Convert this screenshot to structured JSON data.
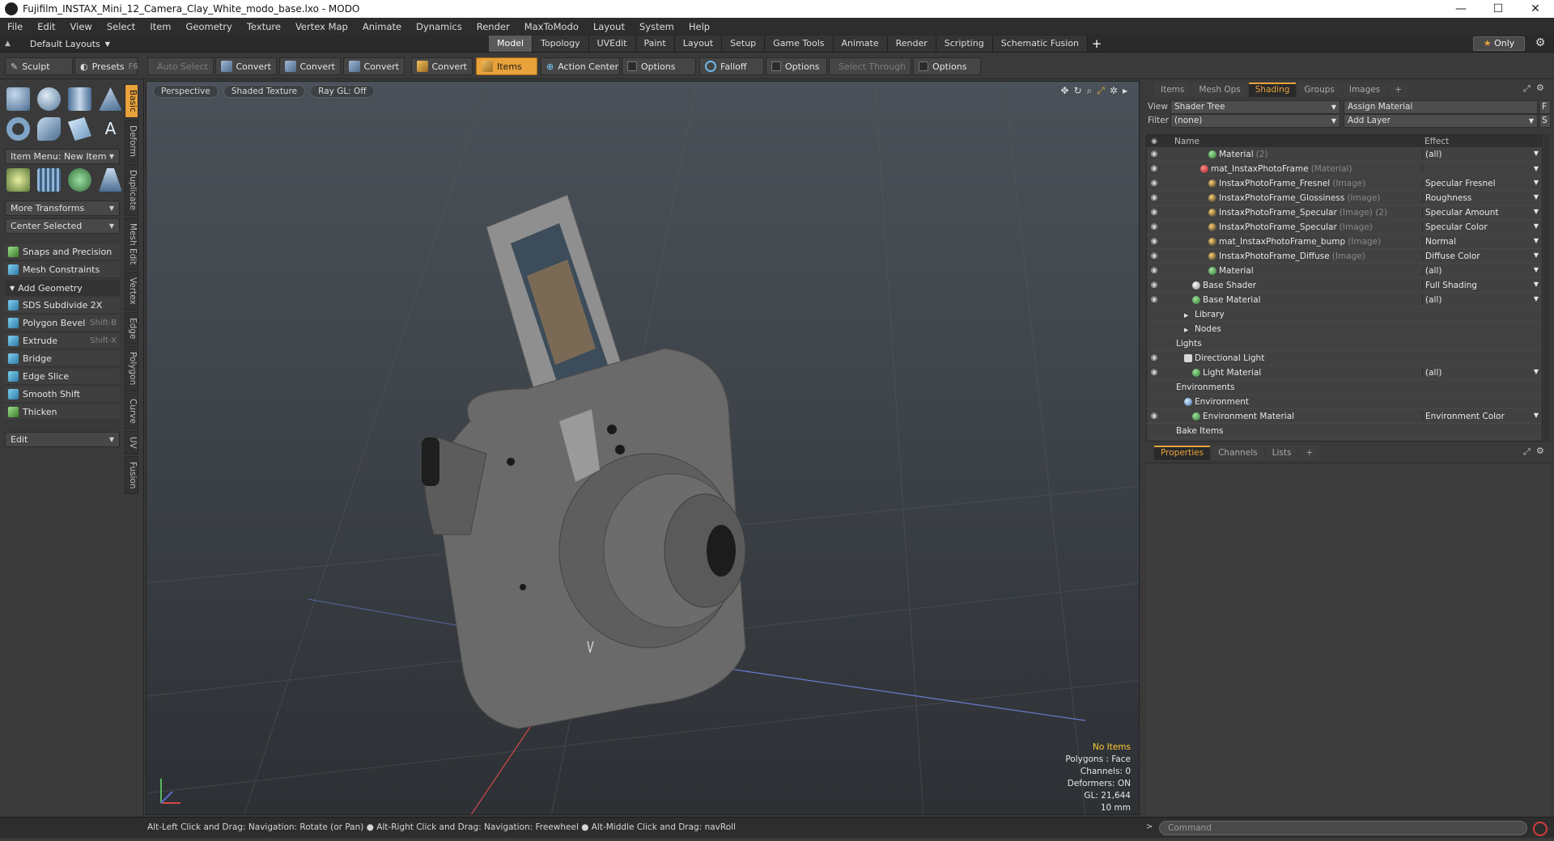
{
  "window": {
    "title": "Fujifilm_INSTAX_Mini_12_Camera_Clay_White_modo_base.lxo - MODO",
    "minimize": "—",
    "maximize": "☐",
    "close": "✕"
  },
  "menu": [
    "File",
    "Edit",
    "View",
    "Select",
    "Item",
    "Geometry",
    "Texture",
    "Vertex Map",
    "Animate",
    "Dynamics",
    "Render",
    "MaxToModo",
    "Layout",
    "System",
    "Help"
  ],
  "layout": {
    "selector": "Default Layouts",
    "tabs": [
      "Model",
      "Topology",
      "UVEdit",
      "Paint",
      "Layout",
      "Setup",
      "Game Tools",
      "Animate",
      "Render",
      "Scripting",
      "Schematic Fusion"
    ],
    "active_tab": "Model",
    "only_label": "Only"
  },
  "toolbar": {
    "sculpt": "Sculpt",
    "presets": "Presets",
    "presets_key": "F6",
    "auto_select": "Auto Select",
    "convert": "Convert",
    "items": "Items",
    "action_center": "Action Center",
    "options": "Options",
    "falloff": "Falloff",
    "select_through": "Select Through"
  },
  "left": {
    "item_menu": "Item Menu: New Item",
    "more_transforms": "More Transforms",
    "center_selected": "Center Selected",
    "snaps": "Snaps and Precision",
    "mesh_constraints": "Mesh Constraints",
    "add_geometry": "Add Geometry",
    "tools": [
      {
        "label": "SDS Subdivide 2X",
        "key": ""
      },
      {
        "label": "Polygon Bevel",
        "key": "Shift-B"
      },
      {
        "label": "Extrude",
        "key": "Shift-X"
      },
      {
        "label": "Bridge",
        "key": ""
      },
      {
        "label": "Edge Slice",
        "key": ""
      },
      {
        "label": "Smooth Shift",
        "key": ""
      },
      {
        "label": "Thicken",
        "key": ""
      }
    ],
    "edit": "Edit",
    "vtabs": [
      "Basic",
      "Deform",
      "Duplicate",
      "Mesh Edit",
      "Vertex",
      "Edge",
      "Polygon",
      "Curve",
      "UV",
      "Fusion"
    ]
  },
  "viewport": {
    "buttons": [
      "Perspective",
      "Shaded Texture",
      "Ray GL: Off"
    ],
    "info": {
      "items": "No Items",
      "polygons": "Polygons : Face",
      "channels": "Channels: 0",
      "deformers": "Deformers: ON",
      "gl": "GL: 21,644",
      "unit": "10 mm"
    }
  },
  "right": {
    "tabs": [
      "Items",
      "Mesh Ops",
      "Shading",
      "Groups",
      "Images"
    ],
    "active_tab": "Shading",
    "view_label": "View",
    "view_value": "Shader Tree",
    "assign_material": "Assign Material",
    "filter_label": "Filter",
    "filter_value": "(none)",
    "add_layer": "Add Layer",
    "col_name": "Name",
    "col_effect": "Effect",
    "rows": [
      {
        "eye": true,
        "indent": 4,
        "icon": "green",
        "name": "Material",
        "sub": "(2)",
        "effect": "(all)",
        "dd": true
      },
      {
        "eye": true,
        "indent": 3,
        "icon": "red",
        "name": "mat_InstaxPhotoFrame",
        "sub": "(Material)",
        "effect": "",
        "dd": true
      },
      {
        "eye": true,
        "indent": 4,
        "icon": "dark",
        "name": "InstaxPhotoFrame_Fresnel",
        "sub": "(Image)",
        "effect": "Specular Fresnel",
        "dd": true
      },
      {
        "eye": true,
        "indent": 4,
        "icon": "dark",
        "name": "InstaxPhotoFrame_Glossiness",
        "sub": "(Image)",
        "effect": "Roughness",
        "dd": true
      },
      {
        "eye": true,
        "indent": 4,
        "icon": "dark",
        "name": "InstaxPhotoFrame_Specular",
        "sub": "(Image) (2)",
        "effect": "Specular Amount",
        "dd": true
      },
      {
        "eye": true,
        "indent": 4,
        "icon": "dark",
        "name": "InstaxPhotoFrame_Specular",
        "sub": "(Image)",
        "effect": "Specular Color",
        "dd": true
      },
      {
        "eye": true,
        "indent": 4,
        "icon": "dark",
        "name": "mat_InstaxPhotoFrame_bump",
        "sub": "(Image)",
        "effect": "Normal",
        "dd": true
      },
      {
        "eye": true,
        "indent": 4,
        "icon": "dark",
        "name": "InstaxPhotoFrame_Diffuse",
        "sub": "(Image)",
        "effect": "Diffuse Color",
        "dd": true
      },
      {
        "eye": true,
        "indent": 4,
        "icon": "green",
        "name": "Material",
        "sub": "",
        "effect": "(all)",
        "dd": true
      },
      {
        "eye": true,
        "indent": 2,
        "icon": "white",
        "name": "Base Shader",
        "sub": "",
        "effect": "Full Shading",
        "dd": true
      },
      {
        "eye": true,
        "indent": 2,
        "icon": "green",
        "name": "Base Material",
        "sub": "",
        "effect": "(all)",
        "dd": true
      },
      {
        "eye": false,
        "indent": 1,
        "icon": "folder",
        "name": "Library",
        "sub": "",
        "effect": "",
        "dd": false
      },
      {
        "eye": false,
        "indent": 1,
        "icon": "folder",
        "name": "Nodes",
        "sub": "",
        "effect": "",
        "dd": false
      },
      {
        "eye": false,
        "indent": 0,
        "icon": "none",
        "name": "Lights",
        "sub": "",
        "effect": "",
        "dd": false
      },
      {
        "eye": true,
        "indent": 1,
        "icon": "light",
        "name": "Directional Light",
        "sub": "",
        "effect": "",
        "dd": false
      },
      {
        "eye": true,
        "indent": 2,
        "icon": "green",
        "name": "Light Material",
        "sub": "",
        "effect": "(all)",
        "dd": true
      },
      {
        "eye": false,
        "indent": 0,
        "icon": "none",
        "name": "Environments",
        "sub": "",
        "effect": "",
        "dd": false
      },
      {
        "eye": false,
        "indent": 1,
        "icon": "env",
        "name": "Environment",
        "sub": "",
        "effect": "",
        "dd": false
      },
      {
        "eye": true,
        "indent": 2,
        "icon": "green",
        "name": "Environment Material",
        "sub": "",
        "effect": "Environment Color",
        "dd": true
      },
      {
        "eye": false,
        "indent": 0,
        "icon": "none",
        "name": "Bake Items",
        "sub": "",
        "effect": "",
        "dd": false
      }
    ],
    "bottom_tabs": [
      "Properties",
      "Channels",
      "Lists"
    ],
    "bottom_active": "Properties"
  },
  "status": {
    "hint": "Alt-Left Click and Drag: Navigation: Rotate (or Pan) ● Alt-Right Click and Drag: Navigation: Freewheel ● Alt-Middle Click and Drag: navRoll",
    "command_placeholder": "Command"
  }
}
